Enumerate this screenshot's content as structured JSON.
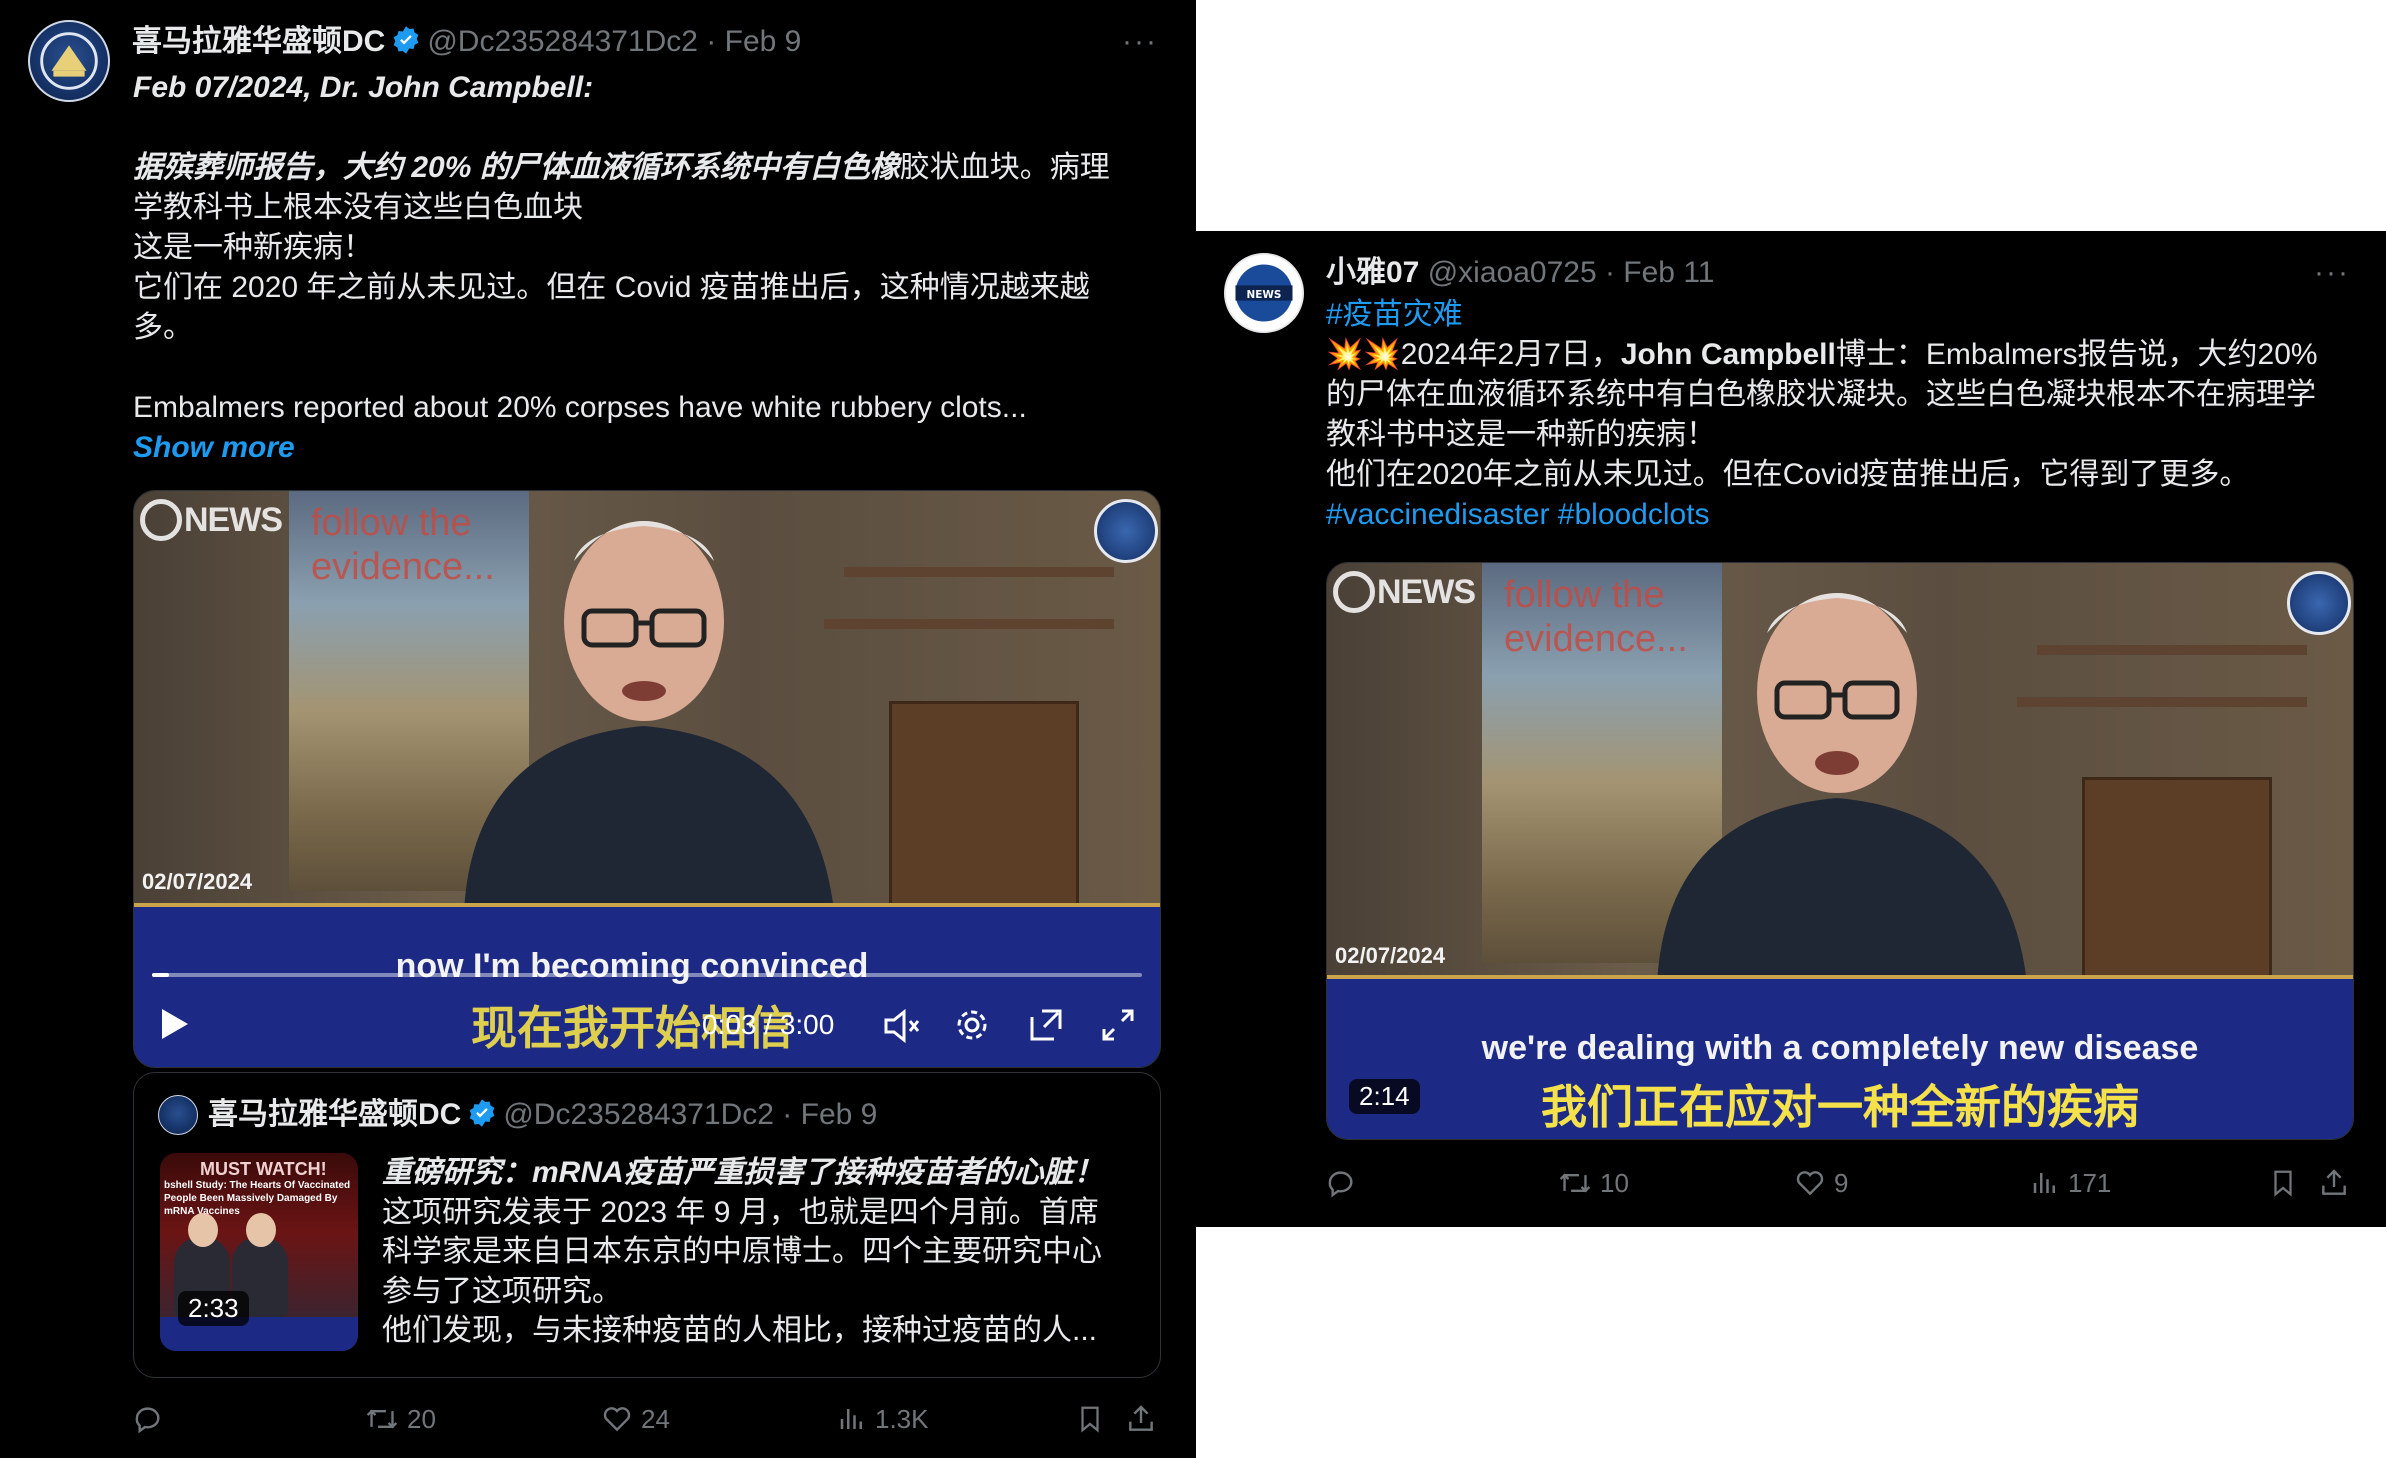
{
  "left_tweet": {
    "author_name": "喜马拉雅华盛顿DC",
    "handle_date": "@Dc235284371Dc2 · Feb 9",
    "more": "···",
    "lines": [
      {
        "text": "Feb 07/2024, Dr. John Campbell:",
        "style": "bi"
      },
      {
        "text": "",
        "style": ""
      },
      {
        "text_bi": "据殡葬师报告，大约 20% 的尸体血液循环系统中有白色橡",
        "text": "胶状血块。病理",
        "style": "mix"
      },
      {
        "text": "学教科书上根本没有这些白色血块",
        "style": ""
      },
      {
        "text": "这是一种新疾病！",
        "style": ""
      },
      {
        "text": "它们在 2020 年之前从未见过。但在 Covid 疫苗推出后，这种情况越来越",
        "style": ""
      },
      {
        "text": "多。",
        "style": ""
      },
      {
        "text": "",
        "style": ""
      },
      {
        "text": "Embalmers reported about 20% corpses have white rubbery clots...",
        "style": ""
      }
    ],
    "show_more": "Show more",
    "video": {
      "brand": "NEWS",
      "poster_text": "follow the evidence...",
      "date": "02/07/2024",
      "subtitle_en": "now I'm becoming convinced",
      "subtitle_zh": "现在我开始相信",
      "time": "0:03 / 3:00",
      "progress": 0.017
    },
    "quote": {
      "author_name": "喜马拉雅华盛顿DC",
      "handle_date": "@Dc235284371Dc2 · Feb 9",
      "thumb_title": "MUST WATCH!",
      "thumb_caption": "bshell Study: The Hearts Of Vaccinated People Been Massively Damaged By mRNA Vaccines",
      "thumb_duration": "2:33",
      "lines": [
        {
          "text": "重磅研究：mRNA疫苗严重损害了接种疫苗者的心脏！",
          "style": "bi"
        },
        {
          "text": "这项研究发表于 2023 年 9 月，也就是四个月前。首席",
          "style": ""
        },
        {
          "text": "科学家是来自日本东京的中原博士。四个主要研究中心",
          "style": ""
        },
        {
          "text": "参与了这项研究。",
          "style": ""
        },
        {
          "text": "他们发现，与未接种疫苗的人相比，接种过疫苗的人...",
          "style": ""
        }
      ]
    },
    "actions": {
      "reply": "",
      "retweet": "20",
      "like": "24",
      "views": "1.3K"
    }
  },
  "right_tweet": {
    "author_name": "小雅07",
    "handle_date": "@xiaoa0725 · Feb 11",
    "more": "···",
    "hashtag_top": "#疫苗灾难",
    "line1_emoji": "💥💥",
    "line1_a": "2024年2月7日，",
    "line1_bold": "John Campbell",
    "line1_b": "博士：Embalmers报告说，大约20%",
    "line2": "的尸体在血液循环系统中有白色橡胶状凝块。这些白色凝块根本不在病理学",
    "line3": "教科书中这是一种新的疾病！",
    "line4": "他们在2020年之前从未见过。但在Covid疫苗推出后，它得到了更多。",
    "hashtags_bottom": "#vaccinedisaster #bloodclots",
    "video": {
      "brand": "NEWS",
      "poster_text": "follow the evidence...",
      "date": "02/07/2024",
      "subtitle_en": "we're dealing with a completely new disease",
      "subtitle_zh": "我们正在应对一种全新的疾病",
      "duration": "2:14"
    },
    "actions": {
      "reply": "",
      "retweet": "10",
      "like": "9",
      "views": "171"
    }
  },
  "colors": {
    "background": "#000000",
    "text": "#e7e9ea",
    "muted": "#71767b",
    "link": "#1d9bf0",
    "subtitle_zh": "#f5e14a",
    "band": "#1c2a86"
  }
}
